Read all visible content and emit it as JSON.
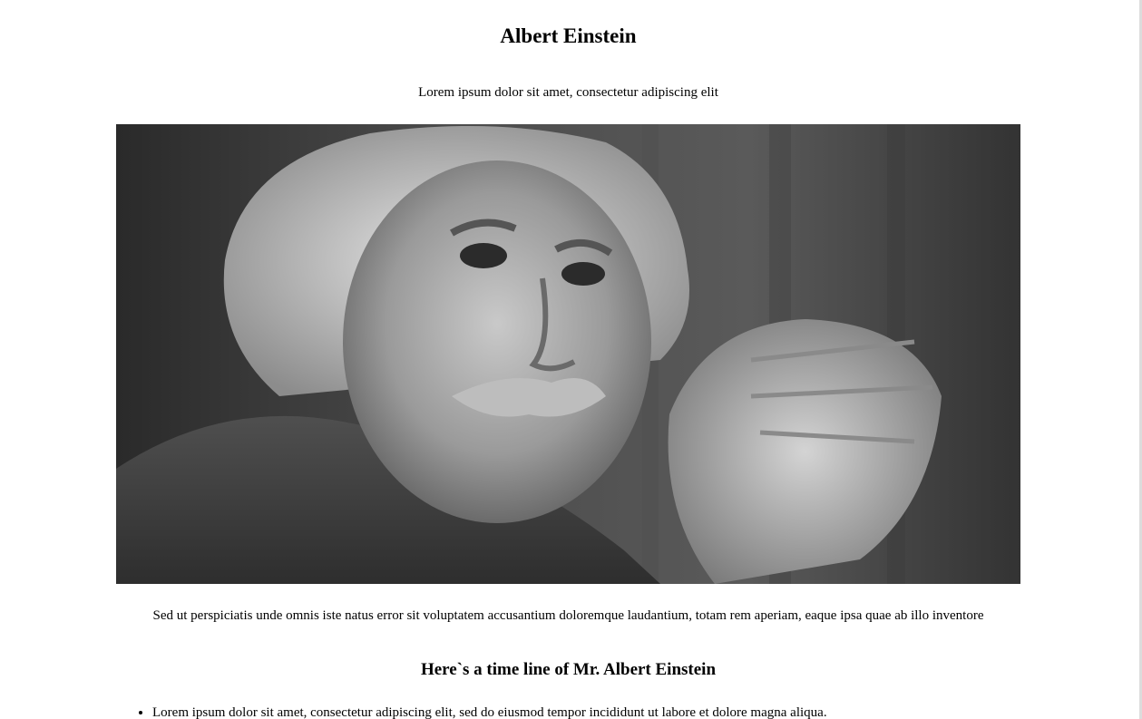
{
  "header": {
    "title": "Albert Einstein",
    "subtitle": "Lorem ipsum dolor sit amet, consectetur adipiscing elit"
  },
  "portrait": {
    "description_name": "einstein-portrait"
  },
  "caption": {
    "text": "Sed ut perspiciatis unde omnis iste natus error sit voluptatem accusantium doloremque laudantium, totam rem aperiam, eaque ipsa quae ab illo inventore"
  },
  "timeline": {
    "heading": "Here`s a time line of Mr. Albert Einstein",
    "items": [
      "Lorem ipsum dolor sit amet, consectetur adipiscing elit, sed do eiusmod tempor incididunt ut labore et dolore magna aliqua."
    ]
  }
}
